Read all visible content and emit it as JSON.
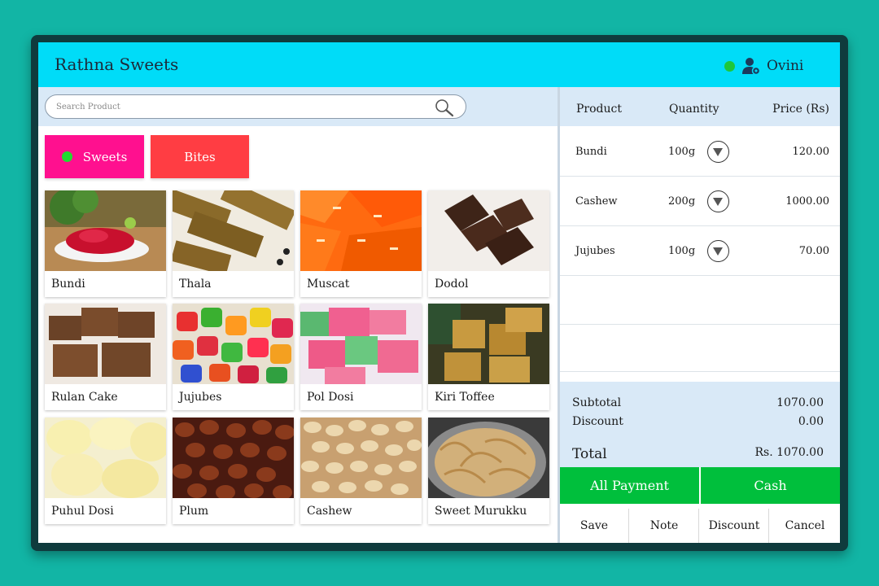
{
  "header": {
    "title": "Rathna Sweets",
    "user_name": "Ovini",
    "status_color": "#1ec73b",
    "bar_color": "#00dcf8"
  },
  "search": {
    "placeholder": "Search Product"
  },
  "categories": [
    {
      "label": "Sweets",
      "color": "#ff108f",
      "active": true
    },
    {
      "label": "Bites",
      "color": "#ff3d43",
      "active": false
    }
  ],
  "products": [
    {
      "name": "Bundi",
      "image": "bundi"
    },
    {
      "name": "Thala",
      "image": "thala"
    },
    {
      "name": "Muscat",
      "image": "muscat"
    },
    {
      "name": "Dodol",
      "image": "dodol"
    },
    {
      "name": "Rulan Cake",
      "image": "rulan-cake"
    },
    {
      "name": "Jujubes",
      "image": "jujubes"
    },
    {
      "name": "Pol Dosi",
      "image": "pol-dosi"
    },
    {
      "name": "Kiri Toffee",
      "image": "kiri-toffee"
    },
    {
      "name": "Puhul Dosi",
      "image": "puhul-dosi"
    },
    {
      "name": "Plum",
      "image": "plum"
    },
    {
      "name": "Cashew",
      "image": "cashew"
    },
    {
      "name": "Sweet Murukku",
      "image": "sweet-murukku"
    }
  ],
  "order": {
    "columns": {
      "product": "Product",
      "quantity": "Quantity",
      "price": "Price (Rs)"
    },
    "items": [
      {
        "product": "Bundi",
        "quantity": "100g",
        "price": "120.00"
      },
      {
        "product": "Cashew",
        "quantity": "200g",
        "price": "1000.00"
      },
      {
        "product": "Jujubes",
        "quantity": "100g",
        "price": "70.00"
      }
    ],
    "subtotal_label": "Subtotal",
    "subtotal": "1070.00",
    "discount_label": "Discount",
    "discount": "0.00",
    "total_label": "Total",
    "total": "Rs. 1070.00"
  },
  "payment": {
    "all_payment": "All Payment",
    "cash": "Cash",
    "color": "#00bf3c"
  },
  "actions": {
    "save": "Save",
    "note": "Note",
    "discount": "Discount",
    "cancel": "Cancel"
  }
}
